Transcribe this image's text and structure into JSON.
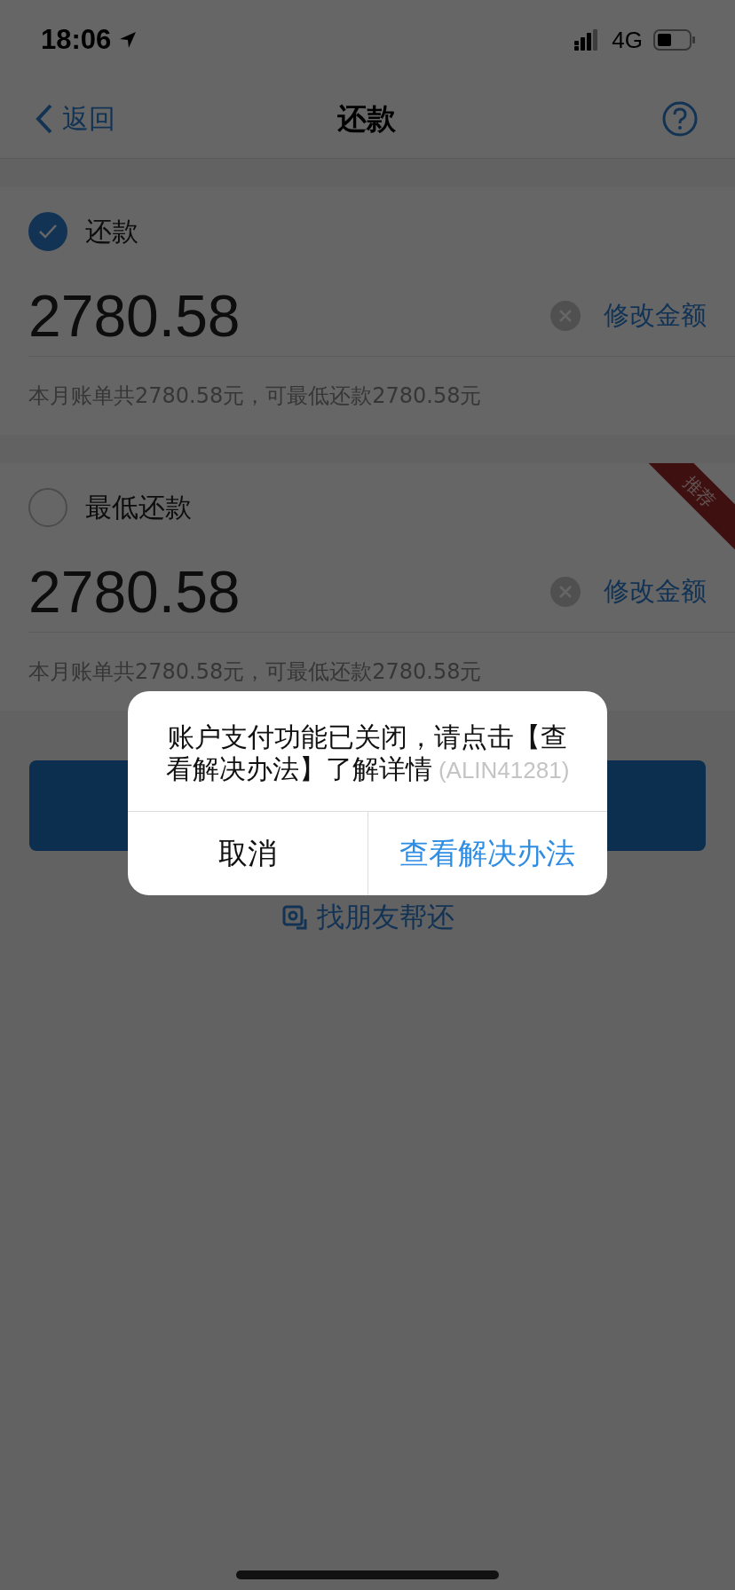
{
  "status_bar": {
    "time": "18:06",
    "network": "4G"
  },
  "nav": {
    "back": "返回",
    "title": "还款"
  },
  "options": [
    {
      "label": "还款",
      "selected": true,
      "amount": "2780.58",
      "edit_link": "修改金额",
      "note": "本月账单共2780.58元，可最低还款2780.58元"
    },
    {
      "label": "最低还款",
      "selected": false,
      "amount": "2780.58",
      "edit_link": "修改金额",
      "note": "本月账单共2780.58元，可最低还款2780.58元",
      "badge": "推荐"
    }
  ],
  "friend_link": "找朋友帮还",
  "dialog": {
    "message": "账户支付功能已关闭，请点击【查看解决办法】了解详情",
    "code": "(ALIN41281)",
    "buttons": [
      {
        "label": "取消",
        "kind": "cancel"
      },
      {
        "label": "查看解决办法",
        "kind": "primary"
      }
    ]
  }
}
